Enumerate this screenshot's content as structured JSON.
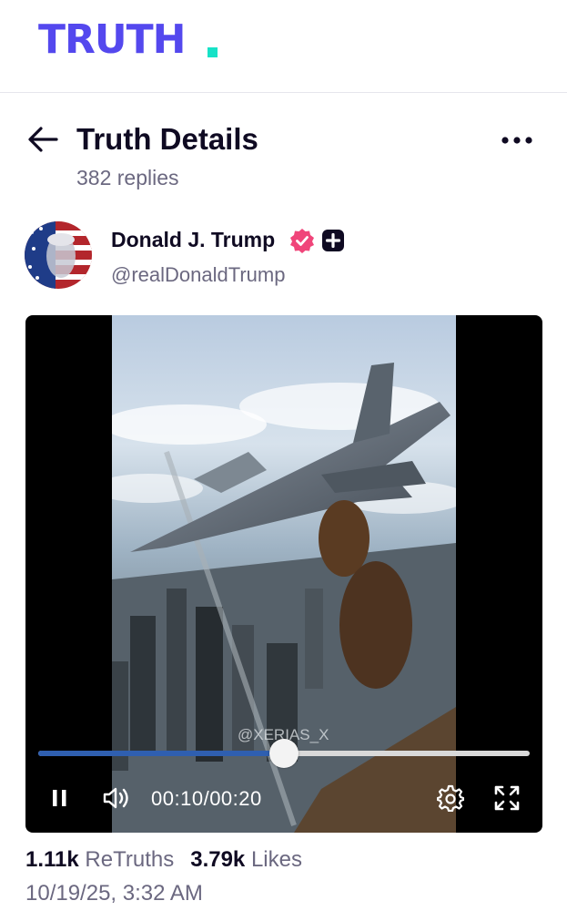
{
  "app": {
    "logo_text": "TRUTH",
    "brand_color": "#5448ee",
    "accent_color": "#17e2c7"
  },
  "header": {
    "title": "Truth Details",
    "replies": "382 replies",
    "back_icon": "arrow-left-icon",
    "more_icon": "more-horizontal-icon"
  },
  "author": {
    "name": "Donald J. Trump",
    "handle": "@realDonaldTrump",
    "verified_color": "#f0457a",
    "badge_icon": "plus-badge-icon"
  },
  "video": {
    "watermark": "@XERIAS_X",
    "current_time": "00:10",
    "duration": "00:20",
    "progress_percent": 50,
    "progress_color": "#2f5fb0"
  },
  "stats": {
    "retruths_count": "1.11k",
    "retruths_label": "ReTruths",
    "likes_count": "3.79k",
    "likes_label": "Likes"
  },
  "timestamp": "10/19/25, 3:32 AM"
}
